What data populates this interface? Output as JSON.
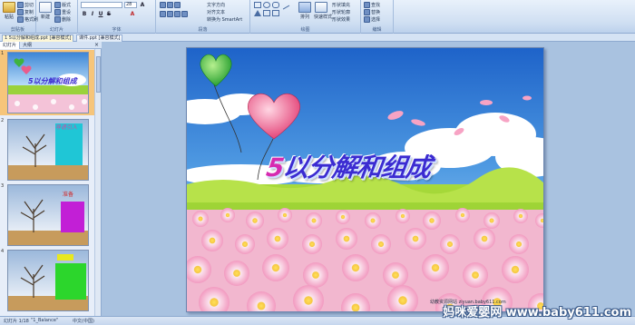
{
  "ribbon": {
    "clipboard_label": "剪贴板",
    "paste_label": "粘贴",
    "cut_label": "剪切",
    "copy_label": "复制",
    "format_painter_label": "格式刷",
    "slides_label": "幻灯片",
    "new_slide_label": "新建",
    "layout_label": "版式",
    "reset_label": "重设",
    "delete_label": "删除",
    "font_label": "字体",
    "font_size": "28",
    "paragraph_label": "段落",
    "text_direction_label": "文字方向",
    "align_text_label": "对齐文本",
    "smartart_label": "转换为 SmartArt",
    "drawing_label": "绘图",
    "arrange_label": "排列",
    "quick_styles_label": "快速样式",
    "fill_label": "形状填充",
    "outline_label": "形状轮廓",
    "effects_label": "形状效果",
    "editing_label": "编辑",
    "find_label": "查找",
    "replace_label": "替换",
    "select_label": "选择"
  },
  "tabs": [
    {
      "label": "1 5以分解和组成.ppt [兼容模式]"
    },
    {
      "label": "课件.ppt [兼容模式]"
    }
  ],
  "pane": {
    "tab_slides": "幻灯片",
    "tab_outline": "大纲",
    "close_glyph": "×"
  },
  "thumbnails": [
    {
      "num": "1"
    },
    {
      "num": "2"
    },
    {
      "num": "3"
    },
    {
      "num": "4"
    }
  ],
  "slide": {
    "title_num": "5",
    "title_rest": "以分解和组成",
    "site": "幼教资源网站 ziyuan.baby611.com"
  },
  "status": {
    "slide_info": "幻灯片 1/18",
    "theme": "\"1_Balance\"",
    "language": "中文(中国)"
  },
  "watermark": "妈咪爱婴网 www.baby611.com",
  "colors": {
    "accent": "#3b2bd1",
    "title_num": "#d62bb0",
    "selection": "#f6c57a"
  }
}
